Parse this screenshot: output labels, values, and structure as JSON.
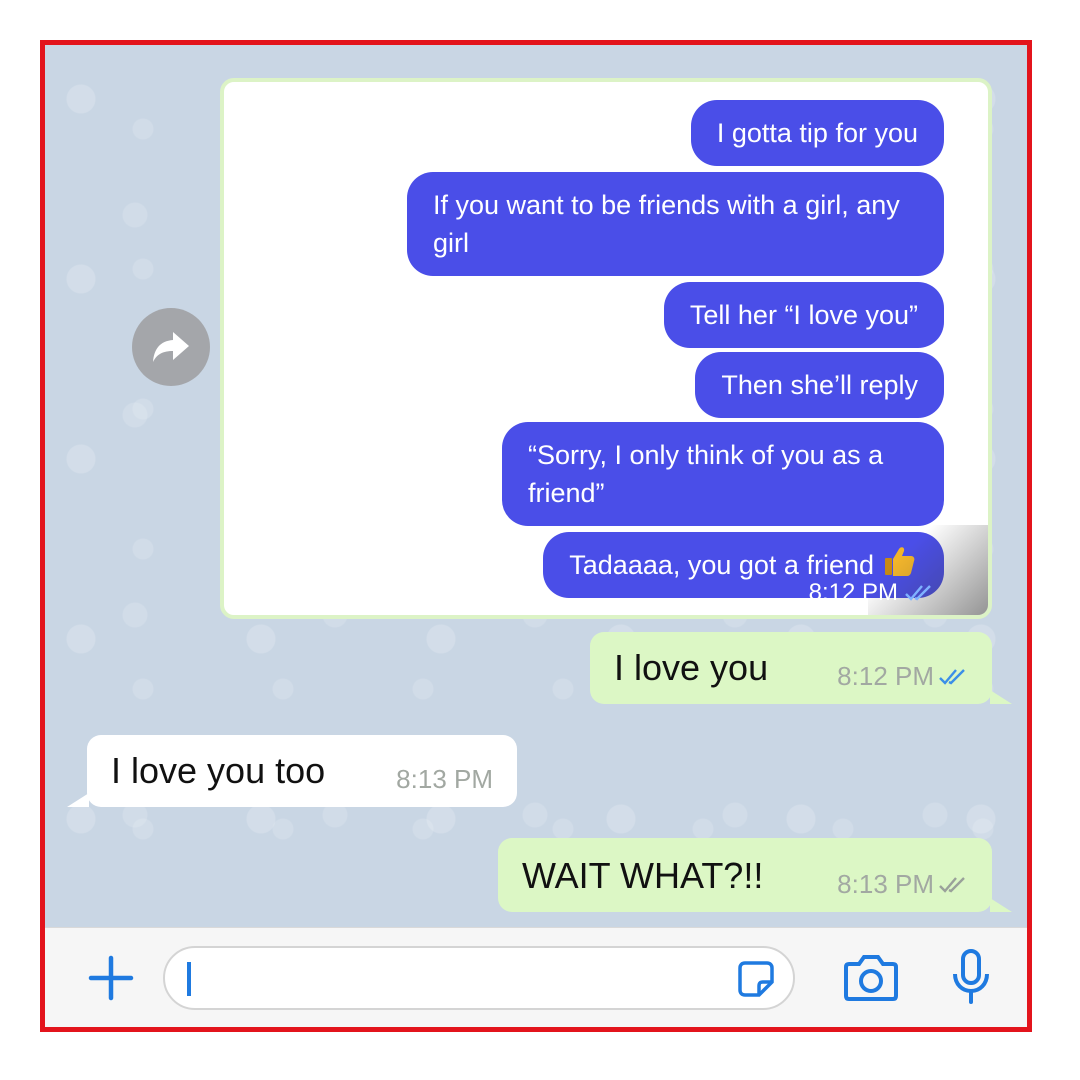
{
  "forwarded": {
    "messages": [
      "I gotta tip for you",
      "If you want to be friends with a girl, any girl",
      "Tell her “I love you”",
      "Then she’ll reply",
      "“Sorry, I only think of you as a friend”",
      "Tadaaaa, you got a friend"
    ],
    "time": "8:12 PM"
  },
  "chat": {
    "msg1": {
      "text": "I love you",
      "time": "8:12 PM",
      "direction": "outgoing",
      "status": "read"
    },
    "msg2": {
      "text": "I love you too",
      "time": "8:13 PM",
      "direction": "incoming"
    },
    "msg3": {
      "text": "WAIT WHAT?!!",
      "time": "8:13 PM",
      "direction": "outgoing",
      "status": "delivered"
    }
  },
  "input": {
    "plus_icon": "plus-icon",
    "sticker_icon": "sticker-icon",
    "camera_icon": "camera-icon",
    "mic_icon": "microphone-icon"
  },
  "colors": {
    "frame_border": "#e3141c",
    "accent_blue": "#1f7ae0",
    "outgoing_bubble": "#dcf7c5",
    "forwarded_bubble": "#4a4ee8"
  }
}
